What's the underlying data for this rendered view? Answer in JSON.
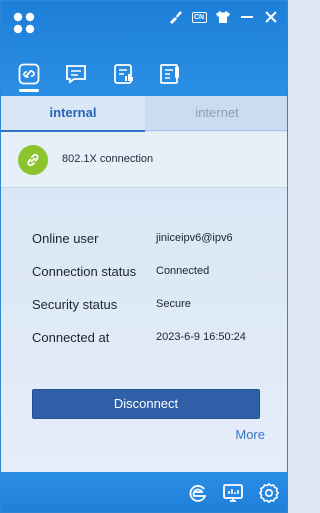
{
  "header": {
    "logo_icon": "app-logo-icon",
    "tools": {
      "skin_icon": "brush-icon",
      "language_label": "CN",
      "shirt_icon": "shirt-icon",
      "minimize_icon": "minimize-icon",
      "close_icon": "close-icon"
    },
    "nav_tabs": [
      {
        "icon": "link-connection-icon",
        "active": true
      },
      {
        "icon": "message-icon",
        "active": false
      },
      {
        "icon": "billing-icon",
        "active": false
      },
      {
        "icon": "notes-icon",
        "active": false
      }
    ]
  },
  "subtabs": {
    "internal_label": "internal",
    "internet_label": "internet"
  },
  "connection": {
    "icon": "link-icon",
    "label": "802.1X  connection"
  },
  "info": {
    "online_user_label": "Online user",
    "online_user_value": "jiniceipv6@ipv6",
    "status_label": "Connection status",
    "status_value": "Connected",
    "security_label": "Security status",
    "security_value": "Secure",
    "connected_at_label": "Connected at",
    "connected_at_value": "2023-6-9 16:50:24"
  },
  "actions": {
    "disconnect_label": "Disconnect",
    "more_label": "More"
  },
  "footer": {
    "icons": [
      "browser-icon",
      "monitor-icon",
      "settings-icon"
    ]
  },
  "colors": {
    "header_blue": "#1e7fd8",
    "accent_green": "#8bc42e",
    "button_blue": "#2f5fa7",
    "link_blue": "#3a74c7"
  }
}
